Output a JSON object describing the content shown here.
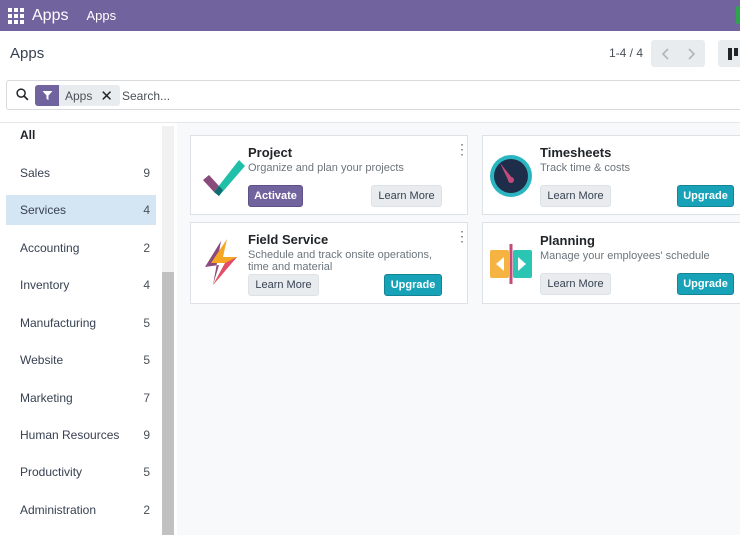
{
  "navbar": {
    "brand": "Apps",
    "menu_item": "Apps"
  },
  "control_panel": {
    "title": "Apps",
    "pager": "1-4 / 4"
  },
  "search": {
    "facet_label": "Apps",
    "placeholder": "Search..."
  },
  "sidebar": {
    "items": [
      {
        "label": "All",
        "count": ""
      },
      {
        "label": "Sales",
        "count": "9"
      },
      {
        "label": "Services",
        "count": "4"
      },
      {
        "label": "Accounting",
        "count": "2"
      },
      {
        "label": "Inventory",
        "count": "4"
      },
      {
        "label": "Manufacturing",
        "count": "5"
      },
      {
        "label": "Website",
        "count": "5"
      },
      {
        "label": "Marketing",
        "count": "7"
      },
      {
        "label": "Human Resources",
        "count": "9"
      },
      {
        "label": "Productivity",
        "count": "5"
      },
      {
        "label": "Administration",
        "count": "2"
      }
    ],
    "active": "Services"
  },
  "apps": [
    {
      "name": "Project",
      "summary": "Organize and plan your projects",
      "primary_action": "Activate",
      "secondary_action": "Learn More",
      "icon": "project-icon"
    },
    {
      "name": "Timesheets",
      "summary": "Track time & costs",
      "primary_action": "Upgrade",
      "secondary_action": "Learn More",
      "icon": "timesheets-icon"
    },
    {
      "name": "Field Service",
      "summary": "Schedule and track onsite operations, time and material",
      "primary_action": "Upgrade",
      "secondary_action": "Learn More",
      "icon": "field-service-icon"
    },
    {
      "name": "Planning",
      "summary": "Manage your employees' schedule",
      "primary_action": "Upgrade",
      "secondary_action": "Learn More",
      "icon": "planning-icon"
    }
  ],
  "colors": {
    "brand": "#71639e",
    "upgrade": "#17a2b8",
    "active_category": "#d4e5f3"
  }
}
